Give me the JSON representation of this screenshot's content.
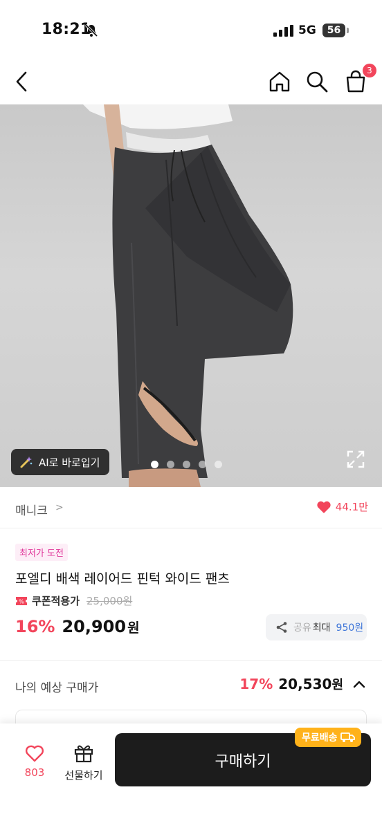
{
  "status": {
    "time": "18:21",
    "network": "5G",
    "battery": "56"
  },
  "nav": {
    "cart_count": "3"
  },
  "hero": {
    "ai_button": "AI로 바로입기",
    "slide_count": 5,
    "active_slide": 0
  },
  "brand": {
    "name": "매니크",
    "likes": "44.1만"
  },
  "product": {
    "badge": "최저가 도전",
    "title": "포엘디 배색 레이어드 핀턱 와이드 팬츠",
    "coupon_label": "쿠폰적용가",
    "original_price": "25,000원",
    "discount": "16%",
    "price": "20,900",
    "price_unit": "원",
    "share_text": "공유",
    "points_prefix": "최대",
    "points": "950원"
  },
  "estimate": {
    "label": "나의 예상 구매가",
    "discount": "17%",
    "price": "20,530",
    "unit": "원"
  },
  "bottom": {
    "wish_count": "803",
    "gift_label": "선물하기",
    "buy_label": "구매하기",
    "free_shipping": "무료배송"
  },
  "colors": {
    "accent": "#f2455b",
    "points": "#3c74d8",
    "badge_bg": "#fdeef7",
    "shipping": "#ffb21a"
  }
}
